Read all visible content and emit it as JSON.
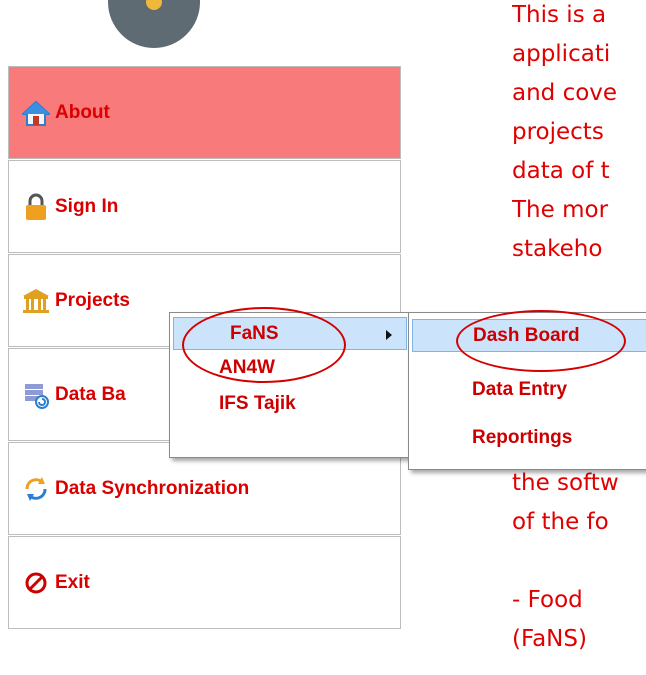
{
  "sidebar": {
    "items": [
      {
        "label": "About",
        "icon": "home-icon",
        "active": true
      },
      {
        "label": "Sign In",
        "icon": "lock-icon"
      },
      {
        "label": "Projects",
        "icon": "bank-icon"
      },
      {
        "label": "Data Ba",
        "icon": "database-restore-icon"
      },
      {
        "label": "Data Synchronization",
        "icon": "sync-icon"
      },
      {
        "label": "Exit",
        "icon": "no-entry-icon"
      }
    ]
  },
  "projects_menu": {
    "items": [
      {
        "label": "FaNS",
        "has_submenu": true
      },
      {
        "label": "AN4W"
      },
      {
        "label": "IFS Tajik"
      }
    ]
  },
  "fans_submenu": {
    "items": [
      {
        "label": "Dash Board"
      },
      {
        "label": "Data Entry"
      },
      {
        "label": "Reportings"
      }
    ]
  },
  "content": {
    "lines": [
      "This is a",
      "applicati",
      "and cove",
      "projects",
      "data of t",
      "The mor",
      "stakeho",
      "",
      "",
      "",
      "",
      "",
      "the softw",
      "of the fo",
      "",
      " - Food",
      "(FaNS)"
    ]
  },
  "colors": {
    "accent_red": "#d90000",
    "active_bg": "#f87a7a",
    "highlight_bg": "#cce4fb"
  }
}
